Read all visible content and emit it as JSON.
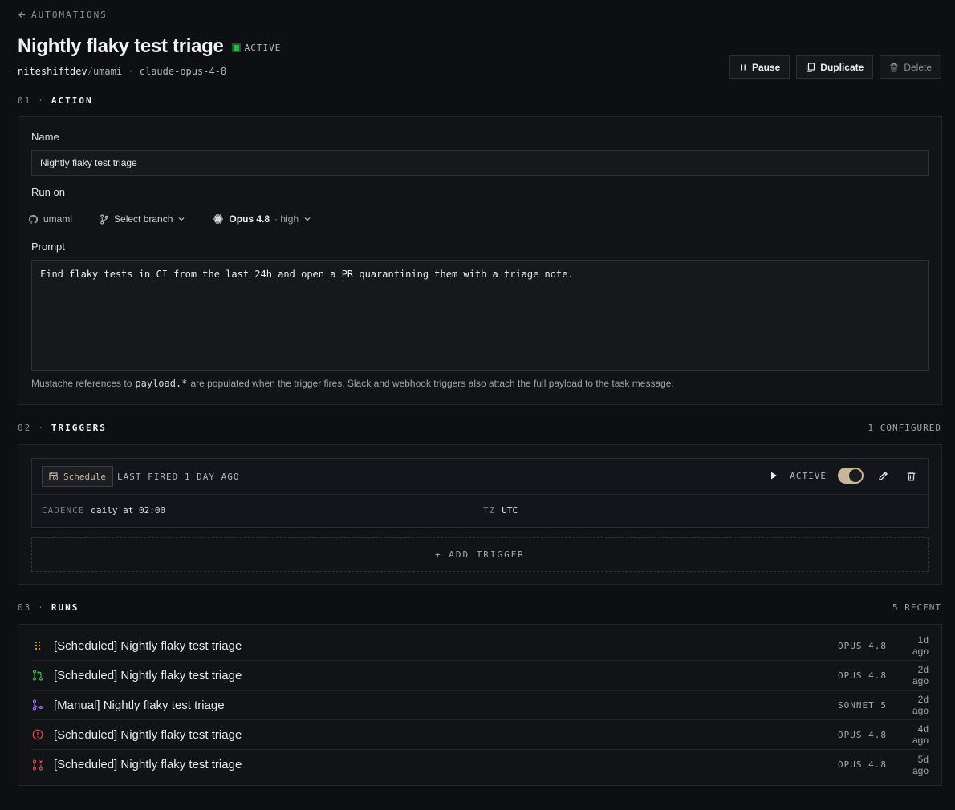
{
  "back": {
    "label": "AUTOMATIONS"
  },
  "header": {
    "title": "Nightly flaky test triage",
    "status": "ACTIVE",
    "owner": "niteshiftdev",
    "repo": "umami",
    "model": "claude-opus-4-8"
  },
  "actions": {
    "pause": "Pause",
    "duplicate": "Duplicate",
    "delete": "Delete"
  },
  "action_section": {
    "number": "01",
    "label": "ACTION",
    "name_label": "Name",
    "name_value": "Nightly flaky test triage",
    "run_on_label": "Run on",
    "repo_chip": "umami",
    "branch_chip": "Select branch",
    "model_chip": "Opus 4.8",
    "effort_chip": "· high",
    "prompt_label": "Prompt",
    "prompt_value": "Find flaky tests in CI from the last 24h and open a PR quarantining them with a triage note.",
    "hint_before": "Mustache references to",
    "hint_code": "payload.*",
    "hint_after": "are populated when the trigger fires. Slack and webhook triggers also attach the full payload to the task message."
  },
  "triggers_section": {
    "number": "02",
    "label": "TRIGGERS",
    "count": "1 CONFIGURED",
    "trigger": {
      "type": "Schedule",
      "last_fired": "LAST FIRED 1 DAY AGO",
      "status": "ACTIVE",
      "enabled": true,
      "cadence_label": "CADENCE",
      "cadence_value": "daily at 02:00",
      "tz_label": "TZ",
      "tz_value": "UTC"
    },
    "add_label": "+ ADD TRIGGER"
  },
  "runs_section": {
    "number": "03",
    "label": "RUNS",
    "count": "5 RECENT",
    "runs": [
      {
        "title": "[Scheduled] Nightly flaky test triage",
        "model": "OPUS 4.8",
        "time": "1d ago",
        "icon": "running-dots-icon",
        "color": "#e0a93a"
      },
      {
        "title": "[Scheduled] Nightly flaky test triage",
        "model": "OPUS 4.8",
        "time": "2d ago",
        "icon": "pull-request-icon",
        "color": "#3fb950"
      },
      {
        "title": "[Manual] Nightly flaky test triage",
        "model": "SONNET 5",
        "time": "2d ago",
        "icon": "merge-icon",
        "color": "#a371f7"
      },
      {
        "title": "[Scheduled] Nightly flaky test triage",
        "model": "OPUS 4.8",
        "time": "4d ago",
        "icon": "alert-circle-icon",
        "color": "#e5484d"
      },
      {
        "title": "[Scheduled] Nightly flaky test triage",
        "model": "OPUS 4.8",
        "time": "5d ago",
        "icon": "pull-request-closed-icon",
        "color": "#e5484d"
      }
    ]
  }
}
